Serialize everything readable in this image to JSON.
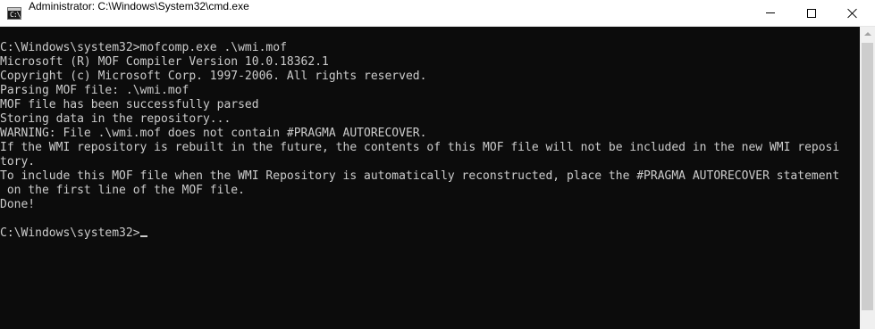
{
  "window": {
    "title": "Administrator: C:\\Windows\\System32\\cmd.exe",
    "icon": "cmd-icon",
    "icon_glyph": "C:\\_",
    "controls": [
      "minimize-icon",
      "maximize-icon",
      "close-icon"
    ]
  },
  "console": {
    "lines": [
      "C:\\Windows\\system32>mofcomp.exe .\\wmi.mof",
      "Microsoft (R) MOF Compiler Version 10.0.18362.1",
      "Copyright (c) Microsoft Corp. 1997-2006. All rights reserved.",
      "Parsing MOF file: .\\wmi.mof",
      "MOF file has been successfully parsed",
      "Storing data in the repository...",
      "WARNING: File .\\wmi.mof does not contain #PRAGMA AUTORECOVER.",
      "If the WMI repository is rebuilt in the future, the contents of this MOF file will not be included in the new WMI reposi",
      "tory.",
      "To include this MOF file when the WMI Repository is automatically reconstructed, place the #PRAGMA AUTORECOVER statement",
      " on the first line of the MOF file.",
      "Done!",
      "",
      "C:\\Windows\\system32>"
    ]
  },
  "colors": {
    "background": "#0c0c0c",
    "text": "#cccccc",
    "titlebar": "#ffffff"
  }
}
